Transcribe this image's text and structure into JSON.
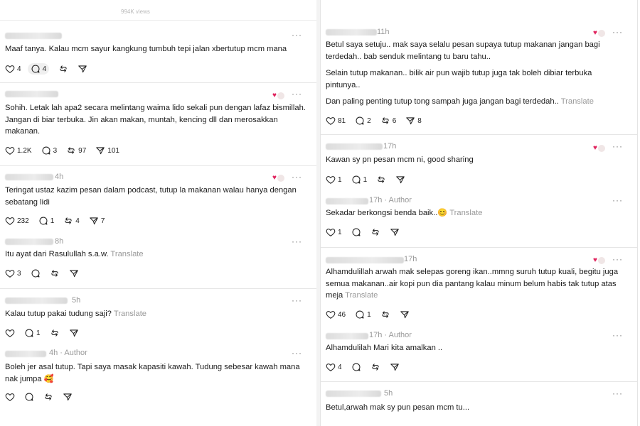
{
  "header": {
    "views": "994K views"
  },
  "icons": {
    "like": "heart-outline-icon",
    "reply": "comment-bubble-icon",
    "repost": "repost-icon",
    "share": "send-icon",
    "liked_by_author": "author-liked-heart-icon",
    "more": "more-dots-icon"
  },
  "left": {
    "c1": {
      "time": "",
      "text": "Maaf tanya. Kalau mcm sayur kangkung tumbuh tepi jalan xbertutup mcm mana",
      "likes": "4",
      "replies": "4",
      "reposts": "",
      "shares": ""
    },
    "c2": {
      "time": "",
      "text": "Sohih. Letak lah apa2 secara melintang waima lido sekali pun dengan lafaz bismillah. Jangan di biar terbuka. Jin akan makan, muntah, kencing dll dan merosakkan makanan.",
      "likes": "1.2K",
      "replies": "3",
      "reposts": "97",
      "shares": "101"
    },
    "c3": {
      "time": "4h",
      "text": "Teringat ustaz kazim pesan dalam podcast, tutup la makanan walau hanya dengan sebatang lidi",
      "likes": "232",
      "replies": "1",
      "reposts": "4",
      "shares": "7"
    },
    "c3r": {
      "time": "8h",
      "text": "Itu ayat dari Rasulullah s.a.w.",
      "translate": "Translate",
      "likes": "3",
      "replies": "",
      "reposts": "",
      "shares": ""
    },
    "c4": {
      "time": "5h",
      "text": "Kalau tutup pakai tudung saji?",
      "translate": "Translate",
      "likes": "",
      "replies": "1",
      "reposts": "",
      "shares": ""
    },
    "c4r": {
      "time": "4h · Author",
      "text": "Boleh jer asal tutup. Tapi saya masak kapasiti kawah. Tudung sebesar kawah mana nak jumpa 🥰",
      "likes": "",
      "replies": "",
      "reposts": "",
      "shares": ""
    }
  },
  "right": {
    "c1": {
      "time": "11h",
      "p1": "Betul saya setuju.. mak saya selalu pesan supaya tutup makanan jangan bagi terdedah.. bab senduk melintang tu baru tahu..",
      "p2": "Selain tutup makanan.. bilik air pun wajib tutup juga tak boleh dibiar terbuka pintunya..",
      "p3": "Dan paling penting tutup tong sampah juga jangan bagi terdedah..",
      "translate": "Translate",
      "likes": "81",
      "replies": "2",
      "reposts": "6",
      "shares": "8"
    },
    "c2": {
      "time": "17h",
      "text": "Kawan sy pn pesan mcm ni, good sharing",
      "likes": "1",
      "replies": "1",
      "reposts": "",
      "shares": ""
    },
    "c2r": {
      "time": "17h · Author",
      "text": "Sekadar berkongsi benda baik..😊",
      "translate": "Translate",
      "likes": "1",
      "replies": "",
      "reposts": "",
      "shares": ""
    },
    "c3": {
      "time": "17h",
      "text": "Alhamdulillah arwah mak selepas goreng ikan..mmng suruh tutup kuali, begitu juga semua makanan..air kopi pun dia pantang kalau minum belum habis tak tutup atas meja",
      "translate": "Translate",
      "likes": "46",
      "replies": "1",
      "reposts": "",
      "shares": ""
    },
    "c3r": {
      "time": "17h · Author",
      "text": "Alhamdulilah Mari kita amalkan ..",
      "likes": "4",
      "replies": "",
      "reposts": "",
      "shares": ""
    },
    "c4": {
      "time": "5h",
      "text": "Betul,arwah mak sy pun pesan mcm tu..."
    }
  }
}
